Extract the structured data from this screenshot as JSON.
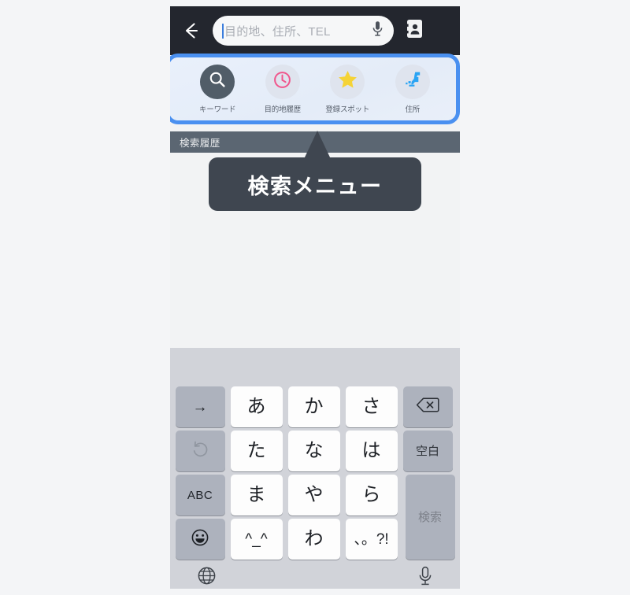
{
  "app": {
    "search": {
      "placeholder": "目的地、住所、TEL",
      "value": "",
      "back_icon": "arrow-left-icon",
      "mic_icon": "microphone-icon",
      "contacts_icon": "contact-card-icon"
    },
    "search_menu": {
      "highlight_color": "#4a90f0",
      "items": [
        {
          "label": "キーワード",
          "icon": "magnifier-icon",
          "icon_color": "#ffffff",
          "circle_color": "#515d68",
          "selected": true
        },
        {
          "label": "目的地履歴",
          "icon": "clock-icon",
          "icon_color": "#f0568c",
          "circle_color": "#dfe4ee",
          "selected": false
        },
        {
          "label": "登録スポット",
          "icon": "star-icon",
          "icon_color": "#f5d336",
          "circle_color": "#dfe4ee",
          "selected": false
        },
        {
          "label": "住所",
          "icon": "japan-map-icon",
          "icon_color": "#2aa4f4",
          "circle_color": "#dfe4ee",
          "selected": false
        }
      ]
    },
    "history": {
      "header": "検索履歴",
      "header_bg": "#5b6672",
      "items": []
    },
    "tooltip": {
      "text": "検索メニュー",
      "bg": "#3f4650"
    },
    "keyboard": {
      "rows": [
        [
          {
            "name": "key-next",
            "label": "→",
            "type": "fn",
            "style": "tiny"
          },
          {
            "name": "key-a",
            "label": "あ",
            "type": "chr",
            "style": ""
          },
          {
            "name": "key-ka",
            "label": "か",
            "type": "chr",
            "style": ""
          },
          {
            "name": "key-sa",
            "label": "さ",
            "type": "chr",
            "style": ""
          },
          {
            "name": "key-backspace",
            "label": "",
            "type": "right",
            "style": "",
            "icon": "backspace-icon"
          }
        ],
        [
          {
            "name": "key-undo",
            "label": "",
            "type": "fn",
            "style": "",
            "icon": "undo-icon"
          },
          {
            "name": "key-ta",
            "label": "た",
            "type": "chr",
            "style": ""
          },
          {
            "name": "key-na",
            "label": "な",
            "type": "chr",
            "style": ""
          },
          {
            "name": "key-ha",
            "label": "は",
            "type": "chr",
            "style": ""
          },
          {
            "name": "key-space",
            "label": "空白",
            "type": "right",
            "style": "small"
          }
        ],
        [
          {
            "name": "key-abc",
            "label": "ABC",
            "type": "fn",
            "style": "abc"
          },
          {
            "name": "key-ma",
            "label": "ま",
            "type": "chr",
            "style": ""
          },
          {
            "name": "key-ya",
            "label": "や",
            "type": "chr",
            "style": ""
          },
          {
            "name": "key-ra",
            "label": "ら",
            "type": "chr",
            "style": ""
          }
        ],
        [
          {
            "name": "key-emoji",
            "label": "",
            "type": "fn",
            "style": "",
            "icon": "smiley-icon"
          },
          {
            "name": "key-kaomoji",
            "label": "^_^",
            "type": "chr",
            "style": "tiny"
          },
          {
            "name": "key-wa",
            "label": "わ",
            "type": "chr",
            "style": ""
          },
          {
            "name": "key-punct",
            "label": "、。?!",
            "type": "chr",
            "style": "tiny"
          }
        ]
      ],
      "search_key": {
        "label": "検索"
      },
      "globe_icon": "globe-icon",
      "dictation_icon": "microphone-icon"
    }
  }
}
